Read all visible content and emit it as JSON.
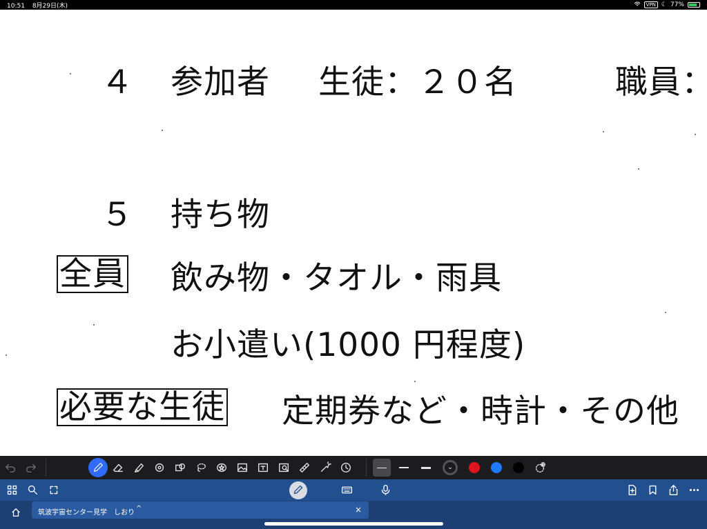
{
  "status_bar": {
    "time": "10:51",
    "date": "8月29日(木)",
    "vpn": "VPN",
    "battery": "77%",
    "battery_level": 0.77
  },
  "document": {
    "line1": {
      "number": "４",
      "label": "参加者",
      "students": "生徒：２０名",
      "staff": "職員："
    },
    "line2": {
      "number": "５",
      "label": "持ち物"
    },
    "line3": {
      "box": "全員",
      "items": "飲み物・タオル・雨具"
    },
    "line4": {
      "items": "お小遣い(1000 円程度)"
    },
    "line5": {
      "box": "必要な生徒",
      "items": "定期券など・時計・その他"
    }
  },
  "toolbar": {
    "tools": [
      "undo-icon",
      "redo-icon",
      "pen-icon",
      "eraser-icon",
      "highlighter-icon",
      "shape-icon",
      "sticker-icon",
      "lasso-icon",
      "star-icon",
      "image-icon",
      "textbox-icon",
      "camera-icon",
      "ruler-icon",
      "laser-icon",
      "timer-icon"
    ],
    "colors": [
      "#1c1c1e",
      "#e0141e",
      "#1e7bff",
      "#000000"
    ]
  },
  "navbar": {
    "icons": [
      "grid-icon",
      "search-icon",
      "pages-icon",
      "pen-mode-icon",
      "keyboard-icon",
      "mic-icon",
      "add-page-icon",
      "bookmark-icon",
      "share-icon",
      "more-icon"
    ]
  },
  "tab": {
    "title": "筑波宇宙センター見学　しおり",
    "chevron": "^",
    "close": "×"
  }
}
